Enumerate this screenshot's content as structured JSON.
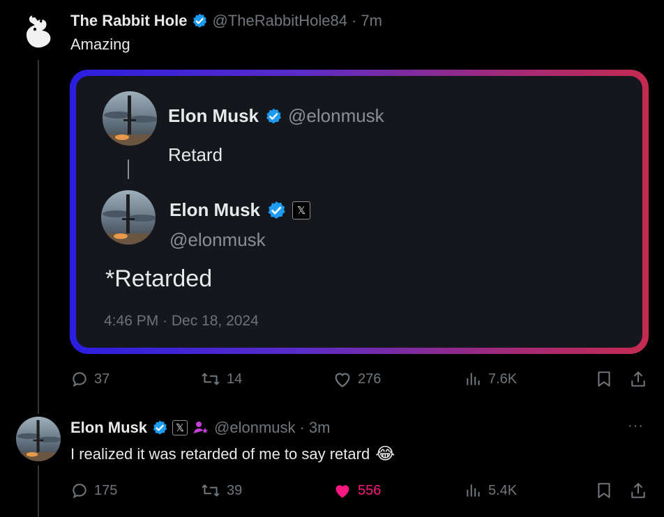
{
  "tweet1": {
    "author_name": "The Rabbit Hole",
    "handle": "@TheRabbitHole84",
    "separator": "·",
    "time": "7m",
    "text": "Amazing",
    "quoted_image": {
      "reply": {
        "author_name": "Elon Musk",
        "handle": "@elonmusk",
        "text": "Retard"
      },
      "original": {
        "author_name": "Elon Musk",
        "handle": "@elonmusk",
        "x_badge": "𝕏",
        "text": "*Retarded",
        "timestamp": "4:46 PM · Dec 18, 2024"
      }
    },
    "actions": {
      "replies": "37",
      "reposts": "14",
      "likes": "276",
      "views": "7.6K"
    }
  },
  "tweet2": {
    "author_name": "Elon Musk",
    "x_badge": "𝕏",
    "handle": "@elonmusk",
    "separator": "·",
    "time": "3m",
    "text": "I realized it was retarded of me to say retard",
    "emoji": "😂",
    "more": "···",
    "actions": {
      "replies": "175",
      "reposts": "39",
      "likes": "556",
      "views": "5.4K"
    }
  },
  "colors": {
    "background": "#000000",
    "text": "#e7e9ea",
    "muted": "#71767b",
    "verified": "#1d9bf0",
    "like": "#f91880",
    "affiliate": "#c43fd8"
  }
}
